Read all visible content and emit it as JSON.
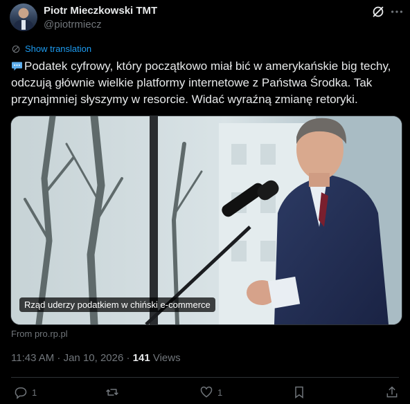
{
  "author": {
    "name": "Piotr Mieczkowski TMT",
    "handle": "@piotrmiecz"
  },
  "icons": {
    "header": [
      "grok-icon",
      "more-icon"
    ],
    "translate": "translate-icon",
    "emoji": "speech-balloon-icon",
    "actions": [
      "reply-icon",
      "retweet-icon",
      "like-icon",
      "bookmark-icon",
      "share-icon"
    ]
  },
  "translation_label": "Show translation",
  "tweet_text": "Podatek cyfrowy, który początkowo miał bić w amerykańskie big techy, odczują głównie wielkie platformy internetowe z Państwa Środka. Tak przynajmniej słyszymy w resorcie. Widać wyraźną zmianę retoryki.",
  "media_caption": "Rząd uderzy podatkiem w chiński e-commerce",
  "source": "From pro.rp.pl",
  "timestamp": "11:43 AM · Jan 10, 2026 · ",
  "views_count": "141",
  "views_label": " Views",
  "actions": {
    "reply_count": "1",
    "retweet_count": "",
    "like_count": "1"
  },
  "colors": {
    "background": "#000000",
    "text": "#e7e9ea",
    "muted": "#71767b",
    "accent": "#1d9bf0"
  }
}
